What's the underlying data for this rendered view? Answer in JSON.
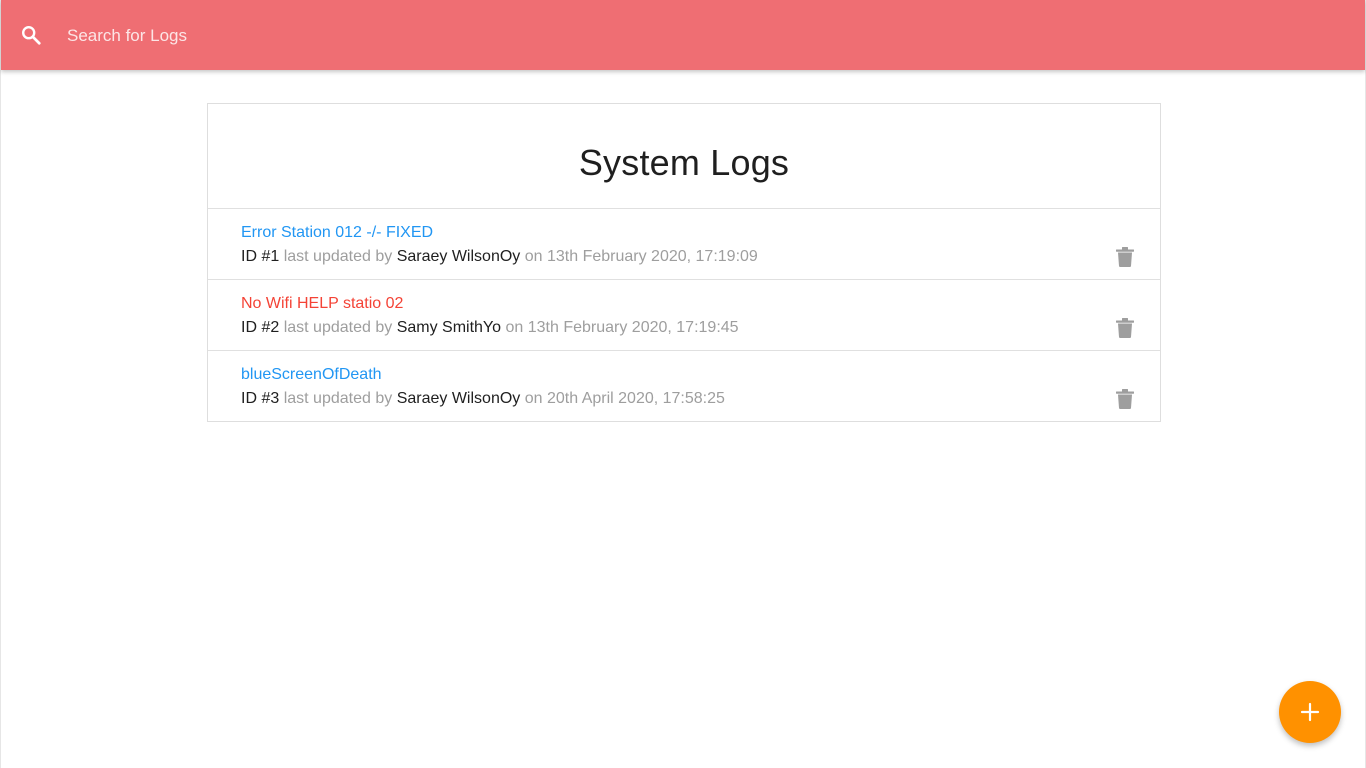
{
  "navbar": {
    "background": "#ef6e73",
    "search_icon": "search-icon",
    "search_placeholder": "Search for Logs",
    "search_value": ""
  },
  "main": {
    "title": "System Logs",
    "logs": [
      {
        "title": "Error Station 012 -/- FIXED",
        "title_color": "#2196f3",
        "id_label": "ID #1",
        "last_updated_by_label": "last updated by",
        "user": "Saraey WilsonOy",
        "on_label": "on",
        "date": "13th February 2020, 17:19:09",
        "delete_icon": "trash-icon"
      },
      {
        "title": "No Wifi HELP statio 02",
        "title_color": "#f44336",
        "id_label": "ID #2",
        "last_updated_by_label": "last updated by",
        "user": "Samy SmithYo",
        "on_label": "on",
        "date": "13th February 2020, 17:19:45",
        "delete_icon": "trash-icon"
      },
      {
        "title": "blueScreenOfDeath",
        "title_color": "#2196f3",
        "id_label": "ID #3",
        "last_updated_by_label": "last updated by",
        "user": "Saraey WilsonOy",
        "on_label": "on",
        "date": "20th April 2020, 17:58:25",
        "delete_icon": "trash-icon"
      }
    ]
  },
  "fab": {
    "icon": "plus-icon",
    "color": "#ff9100"
  }
}
